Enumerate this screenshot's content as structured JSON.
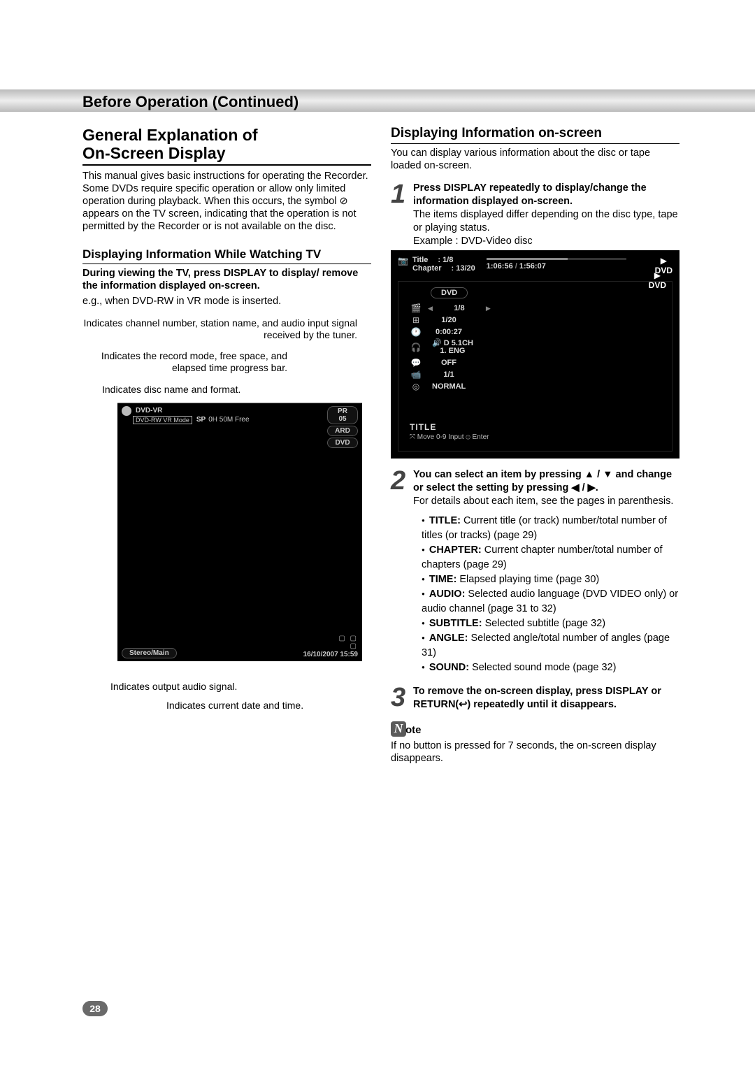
{
  "header": {
    "title": "Before Operation (Continued)"
  },
  "left": {
    "h2_line1": "General Explanation of",
    "h2_line2": "On-Screen Display",
    "intro": "This manual gives basic instructions for operating the Recorder. Some DVDs require specific operation or allow only limited operation during playback. When this occurs, the symbol ⊘ appears on the TV screen, indicating that the operation is not permitted by the Recorder or is not available on the disc.",
    "h3": "Displaying Information While Watching TV",
    "sub_bold": "During viewing the TV, press DISPLAY to display/ remove the information displayed on-screen.",
    "example": "e.g., when DVD-RW in VR mode is inserted.",
    "callout1": "Indicates channel number, station name, and audio input signal received by the tuner.",
    "callout2": "Indicates the record mode, free space, and elapsed time progress bar.",
    "callout3": "Indicates disc name and format.",
    "tv": {
      "disc_label": "DVD-VR",
      "format_box": "DVD-RW  VR Mode",
      "rec_mode": "SP",
      "free": "0H 50M Free",
      "pr": "PR 05",
      "station": "ARD",
      "media": "DVD",
      "audio": "Stereo/Main",
      "datetime": "16/10/2007  15:59"
    },
    "callout4": "Indicates output audio signal.",
    "callout5": "Indicates current date and time."
  },
  "right": {
    "h3": "Displaying Information on-screen",
    "intro": "You can display various information about the disc or tape loaded on-screen.",
    "step1_bold": "Press DISPLAY repeatedly to display/change the information displayed on-screen.",
    "step1_text": "The items displayed differ depending on the disc type, tape or playing status.",
    "step1_example": "Example : DVD-Video disc",
    "osd": {
      "title_label": "Title",
      "title_value": "1/8",
      "chapter_label": "Chapter",
      "chapter_value": "13/20",
      "elapsed": "1:06:56",
      "total": "1:56:07",
      "play": "▶",
      "dvd": "DVD",
      "panel_dvd": "DVD",
      "row_title": "1/8",
      "row_chapter": "1/20",
      "row_time": "0:00:27",
      "row_audio_line1": "🔊 D 5.1CH",
      "row_audio_line2": "1. ENG",
      "row_subtitle": "OFF",
      "row_angle": "1/1",
      "row_sound": "NORMAL",
      "footer_title": "TITLE",
      "footer_hint": "⤧ Move    0-9 Input    ⊙ Enter"
    },
    "step2_bold": "You can select an item by pressing ▲ / ▼ and change or select the setting by pressing ◀ / ▶.",
    "step2_text": "For details about each item, see the pages in parenthesis.",
    "bullets": {
      "b1_label": "TITLE:",
      "b1": " Current title (or track) number/total number of titles (or tracks) (page 29)",
      "b2_label": "CHAPTER:",
      "b2": " Current chapter number/total number of chapters (page 29)",
      "b3_label": "TIME:",
      "b3": " Elapsed playing time (page 30)",
      "b4_label": "AUDIO:",
      "b4": " Selected audio language (DVD VIDEO only) or audio channel (page 31 to 32)",
      "b5_label": "SUBTITLE:",
      "b5": " Selected subtitle (page 32)",
      "b6_label": "ANGLE:",
      "b6": " Selected angle/total number of angles (page 31)",
      "b7_label": "SOUND:",
      "b7": " Selected sound mode (page 32)"
    },
    "step3_bold": "To remove the on-screen display, press DISPLAY or RETURN(↩) repeatedly until it disappears.",
    "note_label": "ote",
    "note_text": "If no button is pressed for 7 seconds, the on-screen display disappears."
  },
  "page_number": "28"
}
